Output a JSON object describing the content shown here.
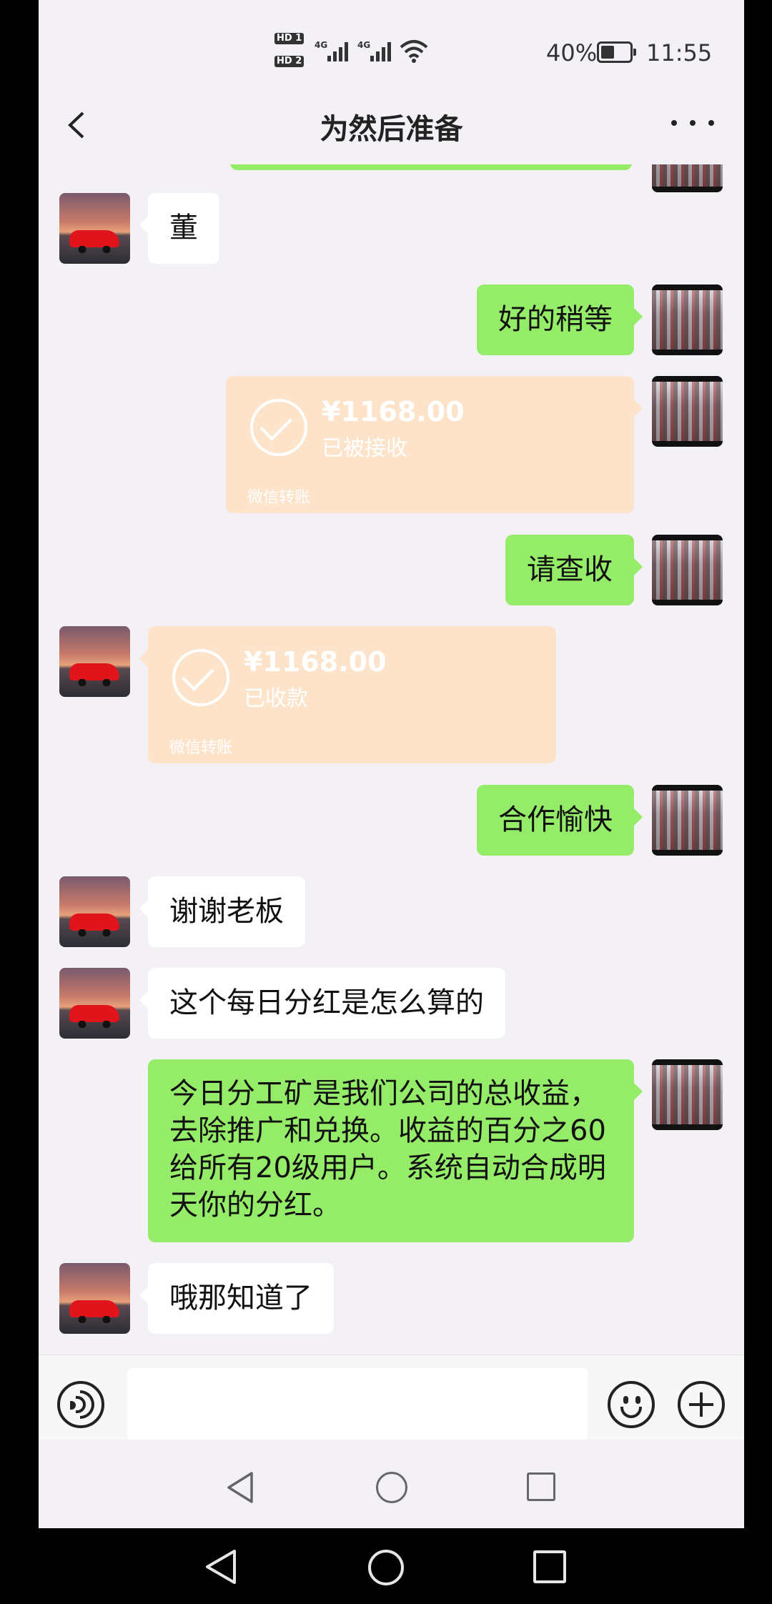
{
  "status_bar": {
    "hd1": "HD 1",
    "hd2": "HD 2",
    "net1": "4G",
    "net2": "4G",
    "battery": "40%",
    "time": "11:55"
  },
  "header": {
    "title": "为然后准备"
  },
  "messages": [
    {
      "side": "left",
      "type": "text",
      "text": "董"
    },
    {
      "side": "right",
      "type": "text",
      "text": "好的稍等"
    },
    {
      "side": "right",
      "type": "transfer",
      "amount": "¥1168.00",
      "status": "已被接收",
      "label": "微信转账"
    },
    {
      "side": "right",
      "type": "text",
      "text": "请查收"
    },
    {
      "side": "left",
      "type": "transfer",
      "amount": "¥1168.00",
      "status": "已收款",
      "label": "微信转账"
    },
    {
      "side": "right",
      "type": "text",
      "text": "合作愉快"
    },
    {
      "side": "left",
      "type": "text",
      "text": "谢谢老板"
    },
    {
      "side": "left",
      "type": "text",
      "text": "这个每日分红是怎么算的"
    },
    {
      "side": "right",
      "type": "text",
      "text": "今日分工矿是我们公司的总收益，去除推广和兑换。收益的百分之60给所有20级用户。系统自动合成明天你的分红。"
    },
    {
      "side": "left",
      "type": "text",
      "text": "哦那知道了"
    }
  ],
  "colors": {
    "chat_bg": "#f3f0f6",
    "sent_bubble": "#95ec69",
    "received_bubble": "#ffffff",
    "transfer_bubble": "#fde3c9"
  },
  "icons": {
    "back": "chevron-left-icon",
    "more": "more-horizontal-icon",
    "voice": "voice-icon",
    "emoji": "emoji-icon",
    "plus": "plus-circle-icon"
  }
}
